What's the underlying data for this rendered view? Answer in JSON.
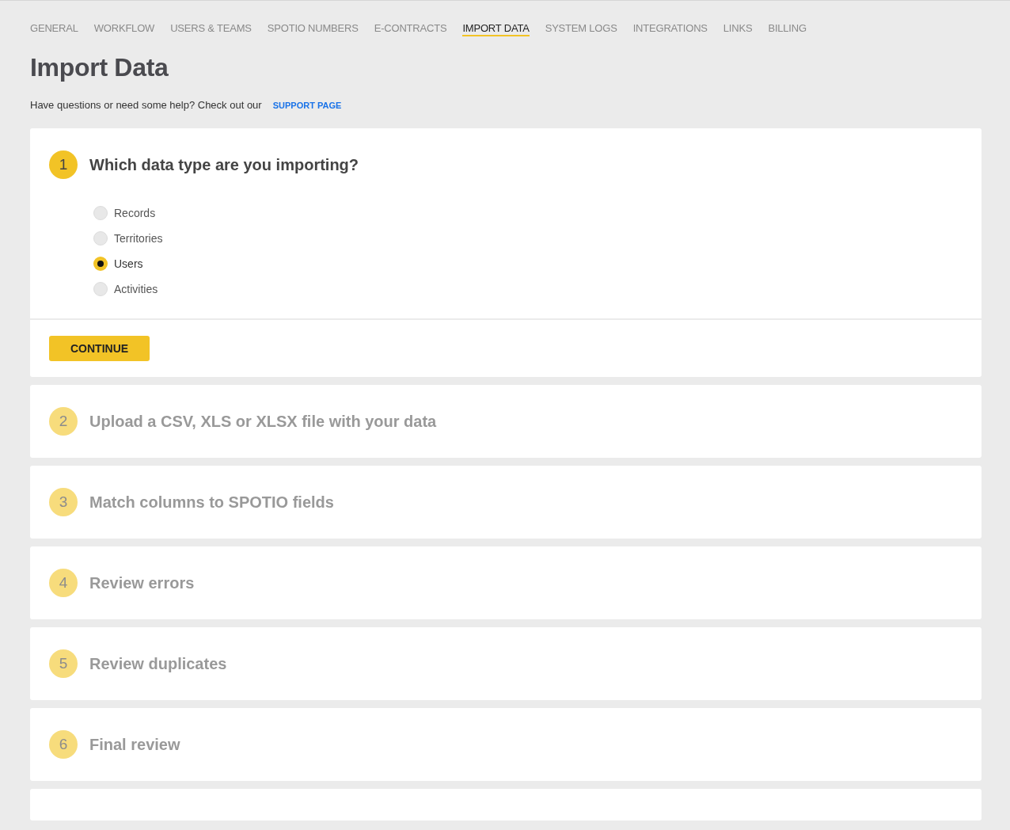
{
  "tabs": [
    {
      "label": "GENERAL",
      "selected": false
    },
    {
      "label": "WORKFLOW",
      "selected": false
    },
    {
      "label": "USERS & TEAMS",
      "selected": false
    },
    {
      "label": "SPOTIO NUMBERS",
      "selected": false
    },
    {
      "label": "E-CONTRACTS",
      "selected": false
    },
    {
      "label": "IMPORT DATA",
      "selected": true
    },
    {
      "label": "SYSTEM LOGS",
      "selected": false
    },
    {
      "label": "INTEGRATIONS",
      "selected": false
    },
    {
      "label": "LINKS",
      "selected": false
    },
    {
      "label": "BILLING",
      "selected": false
    }
  ],
  "page_title": "Import Data",
  "help": {
    "text": "Have questions or need some help? Check out our",
    "link": "SUPPORT PAGE"
  },
  "steps": [
    {
      "number": "1",
      "title": "Which data type are you importing?",
      "active": true,
      "options": [
        {
          "label": "Records",
          "selected": false
        },
        {
          "label": "Territories",
          "selected": false
        },
        {
          "label": "Users",
          "selected": true
        },
        {
          "label": "Activities",
          "selected": false
        }
      ],
      "button": "CONTINUE"
    },
    {
      "number": "2",
      "title": "Upload a CSV, XLS or XLSX file with your data",
      "active": false
    },
    {
      "number": "3",
      "title": "Match columns to SPOTIO fields",
      "active": false
    },
    {
      "number": "4",
      "title": "Review errors",
      "active": false
    },
    {
      "number": "5",
      "title": "Review duplicates",
      "active": false
    },
    {
      "number": "6",
      "title": "Final review",
      "active": false
    }
  ]
}
